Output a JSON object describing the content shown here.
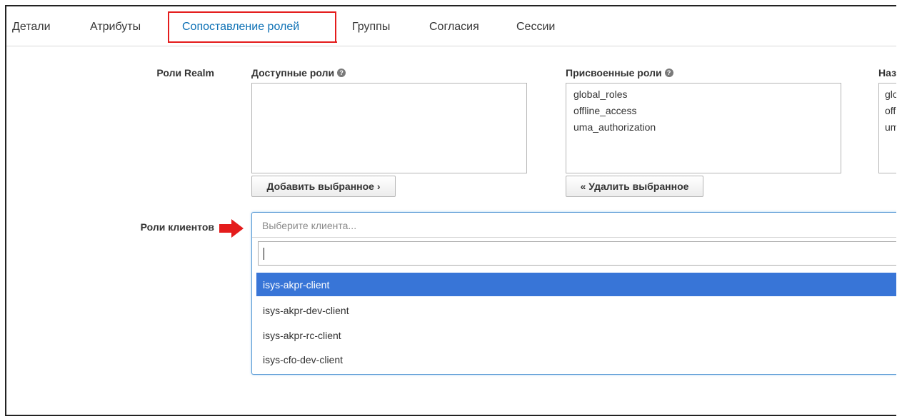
{
  "tabs": [
    {
      "label": "Детали"
    },
    {
      "label": "Атрибуты"
    },
    {
      "label": "Сопоставление ролей",
      "active": true
    },
    {
      "label": "Группы"
    },
    {
      "label": "Согласия"
    },
    {
      "label": "Сессии"
    }
  ],
  "realm_roles": {
    "label": "Роли Realm",
    "available": {
      "title": "Доступные роли",
      "items": []
    },
    "assigned": {
      "title": "Присвоенные роли",
      "items": [
        "global_roles",
        "offline_access",
        "uma_authorization"
      ]
    },
    "effective": {
      "title": "Наз",
      "items": [
        "glo",
        "off",
        "um"
      ]
    },
    "add_button": "Добавить выбранное ›",
    "remove_button": "« Удалить выбранное"
  },
  "client_roles": {
    "label": "Роли клиентов",
    "select_placeholder": "Выберите клиента...",
    "search_value": "",
    "options": [
      {
        "label": "isys-akpr-client",
        "highlighted": true
      },
      {
        "label": "isys-akpr-dev-client"
      },
      {
        "label": "isys-akpr-rc-client"
      },
      {
        "label": "isys-cfo-dev-client"
      }
    ]
  },
  "colors": {
    "active_tab": "#0b6fb4",
    "highlight_box": "#e41c1c",
    "arrow": "#e41c1c",
    "option_highlight": "#3875d7"
  },
  "icons": {
    "help": "question-circle-icon",
    "pointer": "red-arrow-icon"
  }
}
